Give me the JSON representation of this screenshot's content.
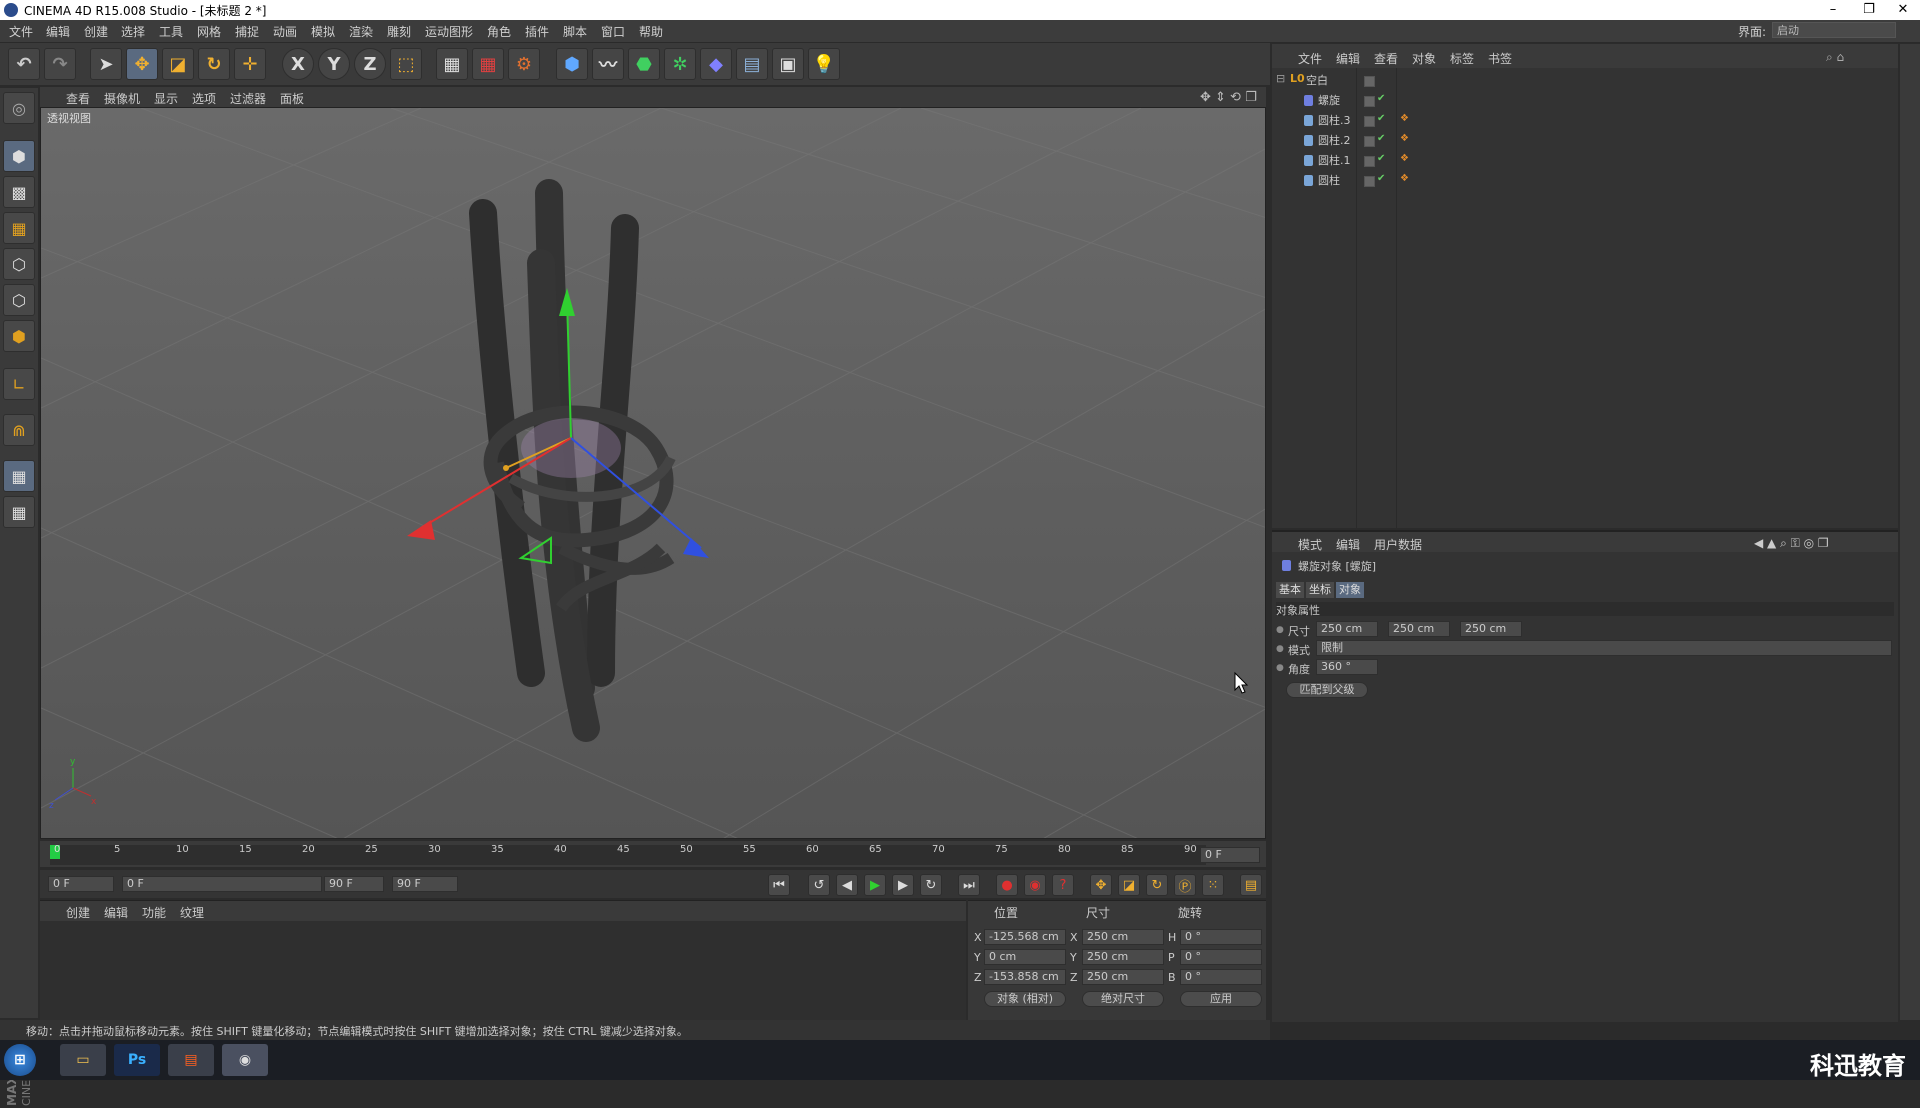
{
  "window": {
    "title": "CINEMA 4D R15.008 Studio - [未标题 2 *]",
    "minimize": "–",
    "restore": "❐",
    "close": "✕"
  },
  "menubar": {
    "items": [
      "文件",
      "编辑",
      "创建",
      "选择",
      "工具",
      "网格",
      "捕捉",
      "动画",
      "模拟",
      "渲染",
      "雕刻",
      "运动图形",
      "角色",
      "插件",
      "脚本",
      "窗口",
      "帮助"
    ],
    "layout_label": "界面:",
    "layout_value": "启动"
  },
  "toolbar": {
    "axis_x": "X",
    "axis_y": "Y",
    "axis_z": "Z"
  },
  "viewport": {
    "menu": [
      "查看",
      "摄像机",
      "显示",
      "选项",
      "过滤器",
      "面板"
    ],
    "label": "透视视图",
    "axis_x": "x",
    "axis_y": "y",
    "axis_z": "z"
  },
  "timeline": {
    "ticks": [
      "0",
      "5",
      "10",
      "15",
      "20",
      "25",
      "30",
      "35",
      "40",
      "45",
      "50",
      "55",
      "60",
      "65",
      "70",
      "75",
      "80",
      "85",
      "90"
    ],
    "current_frame_right": "0 F",
    "start_field": "0 F",
    "range_start": "0 F",
    "range_end": "90 F",
    "end_field": "90 F"
  },
  "material_panel": {
    "menu": [
      "创建",
      "编辑",
      "功能",
      "纹理"
    ]
  },
  "coordinates": {
    "headers": [
      "位置",
      "尺寸",
      "旋转"
    ],
    "rows": [
      {
        "axis": "X",
        "pos": "-125.568 cm",
        "size_axis": "X",
        "size": "250 cm",
        "rot_axis": "H",
        "rot": "0 °"
      },
      {
        "axis": "Y",
        "pos": "0 cm",
        "size_axis": "Y",
        "size": "250 cm",
        "rot_axis": "P",
        "rot": "0 °"
      },
      {
        "axis": "Z",
        "pos": "-153.858 cm",
        "size_axis": "Z",
        "size": "250 cm",
        "rot_axis": "B",
        "rot": "0 °"
      }
    ],
    "mode_object": "对象 (相对)",
    "mode_size": "绝对尺寸",
    "apply": "应用"
  },
  "status": {
    "text": "移动：点击并拖动鼠标移动元素。按住 SHIFT 键量化移动；节点编辑模式时按住 SHIFT 键增加选择对象；按住 CTRL 键减少选择对象。"
  },
  "object_manager": {
    "menu": [
      "文件",
      "编辑",
      "查看",
      "对象",
      "标签",
      "书签"
    ],
    "objects": [
      {
        "name": "空白",
        "type": "null",
        "color": "#e0a020"
      },
      {
        "name": "螺旋",
        "type": "twist",
        "color": "#e0a020"
      },
      {
        "name": "圆柱.3",
        "type": "cylinder",
        "color": "#c8c8c8"
      },
      {
        "name": "圆柱.2",
        "type": "cylinder",
        "color": "#c8c8c8"
      },
      {
        "name": "圆柱.1",
        "type": "cylinder",
        "color": "#c8c8c8"
      },
      {
        "name": "圆柱",
        "type": "cylinder",
        "color": "#c8c8c8"
      }
    ]
  },
  "attributes": {
    "menu": [
      "模式",
      "编辑",
      "用户数据"
    ],
    "object_title": "螺旋对象 [螺旋]",
    "tabs": [
      "基本",
      "坐标",
      "对象"
    ],
    "active_tab": "对象",
    "section": "对象属性",
    "size_label": "尺寸",
    "size_values": [
      "250 cm",
      "250 cm",
      "250 cm"
    ],
    "mode_label": "模式",
    "mode_value": "限制",
    "angle_label": "角度",
    "angle_value": "360 °",
    "fit_button": "匹配到父级"
  },
  "taskbar": {
    "ps_label": "Ps",
    "brand": "科迅教育"
  },
  "colors": {
    "accent_orange": "#e0a020",
    "axis_red": "#e03030",
    "axis_green": "#30d030",
    "axis_blue": "#3050e0",
    "timeline_current": "#22cc44"
  }
}
